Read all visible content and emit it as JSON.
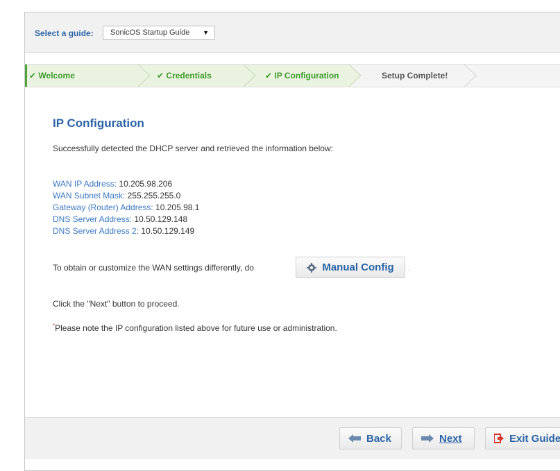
{
  "guide": {
    "label": "Select a guide:",
    "selected": "SonicOS Startup Guide",
    "arrow_icon": "triangle-down-icon"
  },
  "steps": [
    {
      "label": "Welcome",
      "state": "done",
      "prefix": "✔"
    },
    {
      "label": "Credentials",
      "state": "done",
      "prefix": "✔"
    },
    {
      "label": "IP Configuration",
      "state": "current",
      "prefix": "✔"
    },
    {
      "label": "Setup Complete!",
      "state": "todo",
      "prefix": ""
    }
  ],
  "content": {
    "title": "IP Configuration",
    "intro": "Successfully detected the DHCP server and retrieved the information below:",
    "fields": [
      {
        "key": "WAN IP Address:",
        "value": "10.205.98.206"
      },
      {
        "key": "WAN Subnet Mask:",
        "value": "255.255.255.0"
      },
      {
        "key": "Gateway (Router) Address:",
        "value": "10.205.98.1"
      },
      {
        "key": "DNS Server Address:",
        "value": "10.50.129.148"
      },
      {
        "key": "DNS Server Address 2:",
        "value": "10.50.129.149"
      }
    ],
    "customize_text": "To obtain or customize the WAN settings differently, do",
    "manual_config_label": "Manual Config",
    "manual_config_trailing": ".",
    "next_hint": "Click the \"Next\" button to proceed.",
    "note_mark": "*",
    "note": "Please note the IP configuration listed above for future use or administration."
  },
  "footer": {
    "back_label": "Back",
    "next_label": "Next",
    "exit_label": "Exit Guide"
  },
  "colors": {
    "accent_blue": "#2a63a8",
    "link_blue": "#3b78c3",
    "step_green": "#3e9a2c",
    "exit_red": "#d9352b"
  }
}
